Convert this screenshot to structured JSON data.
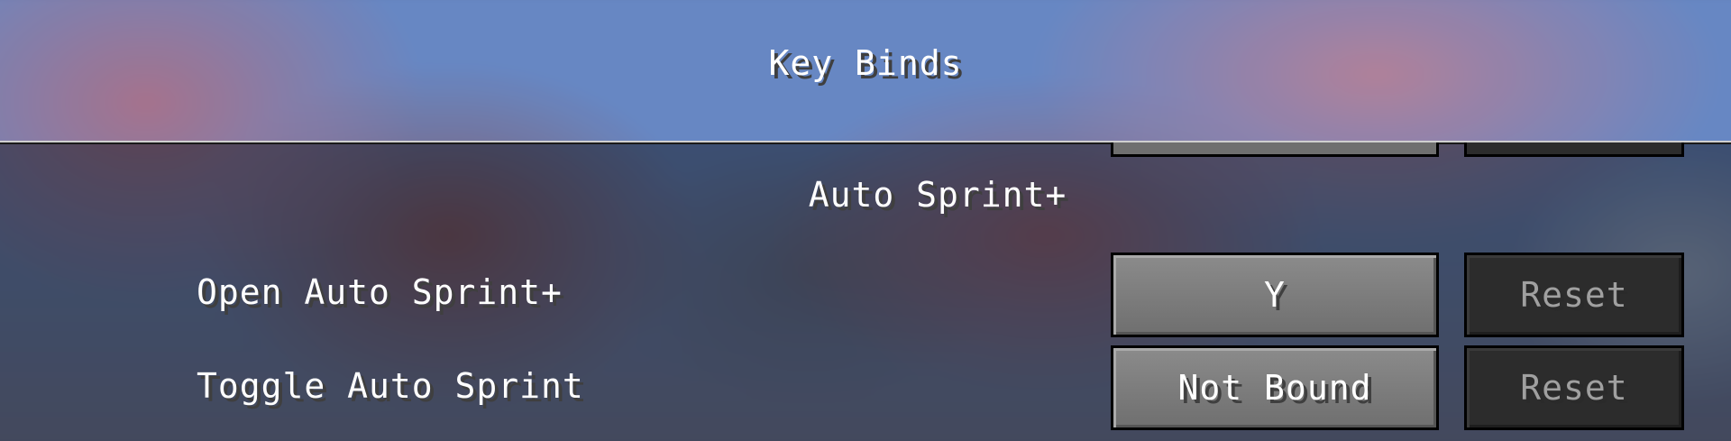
{
  "screen": {
    "title": "Key Binds"
  },
  "category": {
    "label": "Auto Sprint+"
  },
  "bindings": [
    {
      "label": "Open Auto Sprint+",
      "key": "Y",
      "reset_label": "Reset",
      "reset_enabled": false
    },
    {
      "label": "Toggle Auto Sprint",
      "key": "Not Bound",
      "reset_label": "Reset",
      "reset_enabled": false
    }
  ],
  "colors": {
    "text": "#ffffff",
    "text_disabled": "#a0a0a0",
    "button_face": "#7c7c7c",
    "button_disabled": "#2c2c2c",
    "sky": "#6d8fce",
    "blossom": "#b27891"
  }
}
